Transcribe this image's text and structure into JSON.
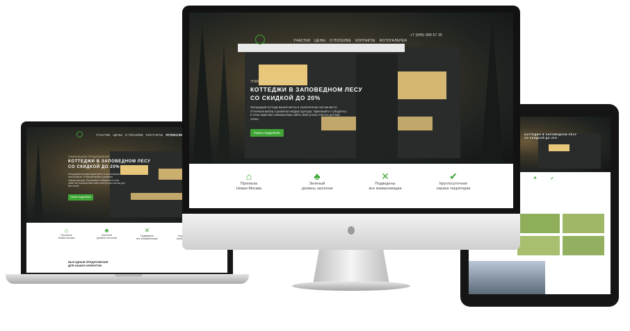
{
  "site": {
    "nav": [
      "УЧАСТКИ",
      "ЦЕНЫ",
      "О ПОСЕЛКЕ",
      "КОНТАКТЫ",
      "ФОТОГАЛЕРЕЯ"
    ],
    "phone": "+7 (945) 999 57 35",
    "kicker": "УНИКАЛЬНОЕ ПРЕДЛОЖЕНИЕ",
    "title_line1": "КОТТЕДЖИ В ЗАПОВЕДНОМ ЛЕСУ",
    "title_line2": "СО СКИДКОЙ ДО 20%",
    "description": "Загородный коттедж вашей мечты в экологически чистом месте. Отличный выбор и развитая инфраструктура. Приезжайте и убедитесь в этом сами! Мы поможем Вам найти свой уголок счастья для Вас лично.",
    "cta_button": "Узнать подробнее",
    "features": [
      {
        "icon": "house-icon",
        "line1": "Прописка",
        "line2": "Новая Москва"
      },
      {
        "icon": "trees-icon",
        "line1": "Зеленый",
        "line2": "уровень экологии"
      },
      {
        "icon": "tools-icon",
        "line1": "Подведены",
        "line2": "все коммуникации"
      },
      {
        "icon": "shield-icon",
        "line1": "Круглосуточная",
        "line2": "охрана территории"
      }
    ],
    "offers_heading_line1": "ВЫГОДНЫЕ ПРЕДЛОЖЕНИЯ",
    "offers_heading_line2": "ДЛЯ НАШИХ КЛИЕНТОВ"
  },
  "colors": {
    "accent": "#3fa535",
    "hero_overlay": "#1e2220",
    "device_frame": "#1a1a1a",
    "device_silver": "#c9c9c9"
  }
}
